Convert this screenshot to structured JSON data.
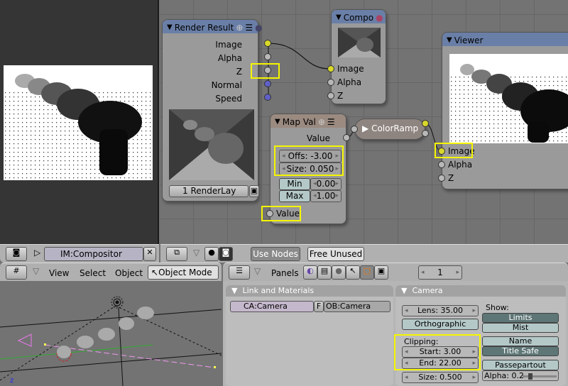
{
  "node_editor": {
    "render_result": {
      "title": "Render Result",
      "outputs": [
        "Image",
        "Alpha",
        "Z",
        "Normal",
        "Speed"
      ],
      "render_layer": "1 RenderLay"
    },
    "composite": {
      "title": "Compo",
      "inputs": [
        "Image",
        "Alpha",
        "Z"
      ]
    },
    "map_value": {
      "title": "Map Val",
      "output": "Value",
      "offset": "Offs: -3.00",
      "size": "Size: 0.050",
      "min_label": "Min",
      "min_value": "0.00",
      "max_label": "Max",
      "max_value": "1.00",
      "input": "Value"
    },
    "colorramp": {
      "title": "ColorRamp"
    },
    "viewer": {
      "title": "Viewer",
      "inputs": [
        "Image",
        "Alpha",
        "Z"
      ]
    }
  },
  "image_header": {
    "image_name": "IM:Compositor"
  },
  "node_header": {
    "use_nodes": "Use Nodes",
    "free_unused": "Free Unused"
  },
  "view3d_header": {
    "menus": [
      "View",
      "Select",
      "Object"
    ],
    "mode": "Object Mode",
    "axis_label": "z"
  },
  "buttons_header": {
    "panels_label": "Panels",
    "frame": "1"
  },
  "link_panel": {
    "title": "Link and Materials",
    "camera_data": "CA:Camera",
    "fake_user": "F",
    "object": "OB:Camera"
  },
  "camera_panel": {
    "title": "Camera",
    "lens": "Lens: 35.00",
    "orthographic": "Orthographic",
    "clipping_label": "Clipping:",
    "clip_start": "Start: 3.00",
    "clip_end": "End: 22.00",
    "size": "Size: 0.500",
    "show_label": "Show:",
    "limits": "Limits",
    "mist": "Mist",
    "name": "Name",
    "title_safe": "Title Safe",
    "passepartout": "Passepartout",
    "alpha": "Alpha: 0.2",
    "alpha_value": 0.2
  }
}
